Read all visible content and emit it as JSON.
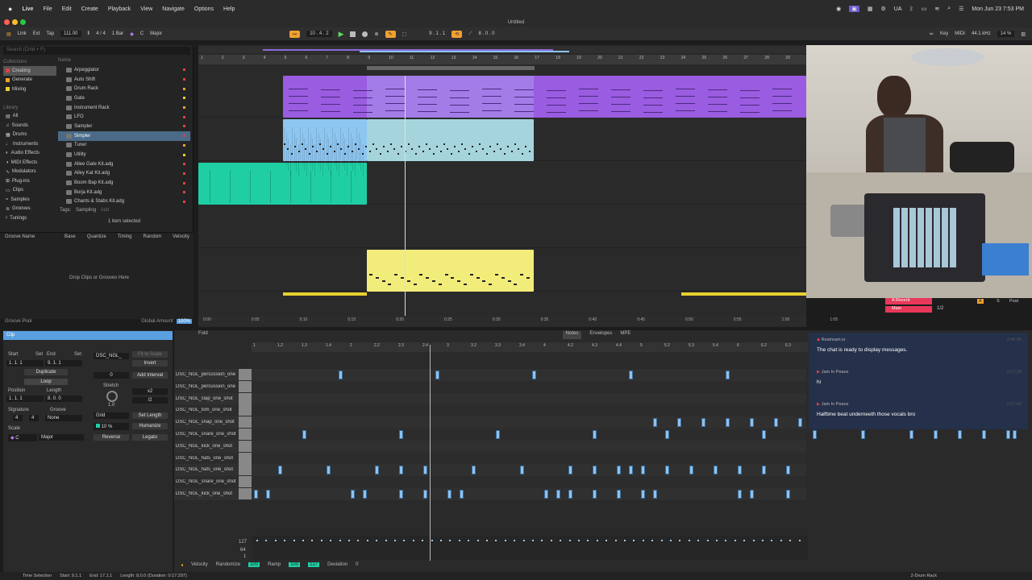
{
  "menubar": {
    "app": "Live",
    "items": [
      "File",
      "Edit",
      "Create",
      "Playback",
      "View",
      "Navigate",
      "Options",
      "Help"
    ],
    "lang": "UA",
    "clock": "Mon Jun 23  7:53 PM"
  },
  "window": {
    "title": "Untitled"
  },
  "transport": {
    "link": "Link",
    "ext": "Ext",
    "tap": "Tap",
    "tempo": "111.00",
    "signature": "4 / 4",
    "quantize": "1 Bar",
    "key": "C",
    "scale": "Major",
    "position": "10 .  4 .  2",
    "loop_start": "9 .  1 .  1",
    "loop_length": "8 .  0 .  0",
    "key_button": "Key",
    "midi": "MIDI",
    "sample_rate": "44.1 kHz",
    "cpu": "14 %"
  },
  "browser": {
    "search_placeholder": "Search (Cmd + F)",
    "collections_label": "Collections",
    "collections": [
      {
        "label": "Creating",
        "color": "#e04040",
        "selected": true
      },
      {
        "label": "Generate",
        "color": "#f0a030"
      },
      {
        "label": "Mixing",
        "color": "#e8d030"
      }
    ],
    "library_label": "Library",
    "library": [
      "All",
      "Sounds",
      "Drums",
      "Instruments",
      "Audio Effects",
      "MIDI Effects",
      "Modulators",
      "Plug-ins",
      "Clips",
      "Samples",
      "Grooves",
      "Tunings"
    ],
    "name_header": "Name",
    "items": [
      {
        "label": "Arpeggiator",
        "dot": "#e04040"
      },
      {
        "label": "Auto Shift",
        "dot": "#e04040"
      },
      {
        "label": "Drum Rack",
        "dot": "#f0a030"
      },
      {
        "label": "Gate",
        "dot": "#e8d030"
      },
      {
        "label": "Instrument Rack",
        "dot": "#f0a030"
      },
      {
        "label": "LFO",
        "dot": "#e04040"
      },
      {
        "label": "Sampler",
        "dot": "#e04040"
      },
      {
        "label": "Simpler",
        "dot": "#e04040",
        "selected": true
      },
      {
        "label": "Tuner",
        "dot": "#f0a030"
      },
      {
        "label": "Utility",
        "dot": "#e8d030"
      },
      {
        "label": "Allee Gate Kit.adg",
        "dot": "#e04040"
      },
      {
        "label": "Alley Kat Kit.adg",
        "dot": "#e04040"
      },
      {
        "label": "Boom Bap Kit.adg",
        "dot": "#e04040"
      },
      {
        "label": "Borja Kit.adg",
        "dot": "#e04040"
      },
      {
        "label": "Chants & Stabs Kit.adg",
        "dot": "#e04040"
      }
    ],
    "tags_label": "Tags:",
    "tag1": "Sampling",
    "tag2": "Add",
    "selection_info": "1 item selected"
  },
  "groove": {
    "headers": [
      "Groove Name",
      "Base",
      "Quantize",
      "Timing",
      "Random",
      "Velocity"
    ],
    "drop_text": "Drop Clips or Grooves Here",
    "pool_label": "Groove Pool",
    "global_label": "Global Amount",
    "global_value": "100%"
  },
  "arrangement": {
    "ruler": [
      "1",
      "2",
      "3",
      "4",
      "5",
      "6",
      "7",
      "8",
      "9",
      "10",
      "11",
      "12",
      "13",
      "14",
      "15",
      "16",
      "17",
      "18",
      "19",
      "20",
      "21",
      "22",
      "23",
      "24",
      "25",
      "26",
      "27",
      "28",
      "29"
    ],
    "times": [
      "0:00",
      "0:05",
      "0:10",
      "0:15",
      "0:20",
      "0:25",
      "0:30",
      "0:35",
      "0:40",
      "0:45",
      "0:50",
      "0:55",
      "1:00",
      "1:05"
    ]
  },
  "clip_view": {
    "title": "Clip",
    "clip_name": "DSC_NGL_",
    "start_label": "Start",
    "end_label": "End",
    "set": "Set",
    "start": "1.  1.  1",
    "end": "9.  1.  1",
    "duplicate": "Duplicate",
    "loop": "Loop",
    "position_label": "Position",
    "length_label": "Length",
    "position": "1.  1.  1",
    "length": "8.  0.  0",
    "signature_label": "Signature",
    "groove_label": "Groove",
    "sig_num": "4",
    "sig_den": "4",
    "groove_value": "None",
    "scale_label": "Scale",
    "scale_key": "C",
    "scale_name": "Major",
    "fit_to_scale": "Fit to Scale",
    "invert": "Invert",
    "interval_value": "0",
    "add_interval": "Add Interval",
    "stretch": "Stretch",
    "stretch_value": "1.0",
    "x2": "x2",
    "div2": "/2",
    "grid": "Grid",
    "set_length": "Set Length",
    "grid_percent": "10 %",
    "humanize": "Humanize",
    "reverse": "Reverse",
    "legato": "Legato"
  },
  "midi_editor": {
    "fold": "Fold",
    "notes_tab": "Notes",
    "envelopes_tab": "Envelopes",
    "mpe_tab": "MPE",
    "ruler": [
      "1",
      "1.2",
      "1.3",
      "1.4",
      "2",
      "2.2",
      "2.3",
      "2.4",
      "3",
      "3.2",
      "3.3",
      "3.4",
      "4",
      "4.2",
      "4.3",
      "4.4",
      "5",
      "5.2",
      "5.3",
      "5.4",
      "6",
      "6.2",
      "6.3"
    ],
    "lanes": [
      "DSC_NGL_percussion_one",
      "DSC_NGL_percussion_one",
      "DSC_NGL_clap_one_shot",
      "DSC_NGL_tom_one_shot",
      "DSC_NGL_snap_one_shot",
      "DSC_NGL_snare_one_shot",
      "DSC_NGL_kick_one_shot",
      "DSC_NGL_hats_one_shot",
      "DSC_NGL_hats_one_shot",
      "DSC_NGL_snare_one_shot",
      "DSC_NGL_kick_one_shot"
    ],
    "vel_top": "127",
    "vel_mid": "64",
    "vel_bot": "1",
    "velocity_label": "Velocity",
    "randomize": "Randomize",
    "rand_value": "100",
    "ramp": "Ramp",
    "ramp_start": "100",
    "ramp_end": "127",
    "deviation": "Deviation",
    "deviation_value": "0"
  },
  "chat": {
    "messages": [
      {
        "user": "Restream.io",
        "text": "The chat is ready to display messages.",
        "time": "3:45:35"
      },
      {
        "user": "Jam In Peace",
        "text": "hi",
        "time": "0:17:38"
      },
      {
        "user": "Jam In Peace",
        "text": "Halftime beat underneeth those vocals bro",
        "time": "0:17:46"
      }
    ]
  },
  "status_bar": {
    "mode": "Time Selection",
    "start": "Start: 9.1.1",
    "end": "End: 17.1.1",
    "length": "Length: 8.0.0 (Duration: 0:17:297)",
    "device": "2-Drum Rack"
  },
  "mixer": {
    "return_a": "A Reverb",
    "main": "Main",
    "ratio": "1/2",
    "a": "A",
    "s": "S",
    "post": "Post"
  }
}
